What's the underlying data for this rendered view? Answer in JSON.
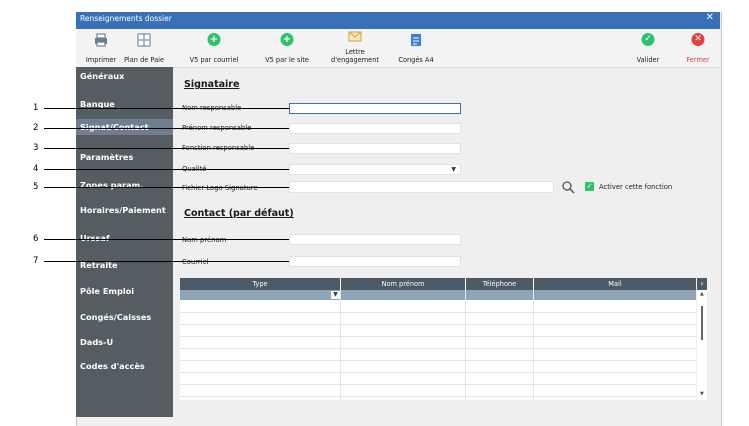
{
  "window": {
    "title": "Renseignements dossier",
    "close": "✕"
  },
  "toolbar": {
    "print": "Imprimer",
    "plan": "Plan de Paie",
    "v5_mail": "V5 par courriel",
    "v5_site": "V5 par le site",
    "letter_line1": "Lettre",
    "letter_line2": "d'engagement",
    "conges": "Congés A4",
    "validate": "Valider",
    "close": "Fermer"
  },
  "sidebar": {
    "items": [
      "Généraux",
      "Banque",
      "Signat/Contact",
      "Paramètres",
      "Zones param.",
      "Horaires/Paiement",
      "Urssaf",
      "Retraite",
      "Pôle Emploi",
      "Congés/Caisses",
      "Dads-U",
      "Codes d'accès"
    ],
    "selected": "Signat/Contact"
  },
  "signataire": {
    "heading": "Signataire",
    "nom_label": "Nom responsable",
    "prenom_label": "Prénom responsable",
    "fonction_label": "Fonction responsable",
    "qualite_label": "Qualité",
    "logo_label": "Fichier Logo Signature",
    "activate_label": "Activer cette fonction",
    "activate_checked": true
  },
  "contact": {
    "heading": "Contact (par défaut)",
    "nom_label": "Nom prénom",
    "courriel_label": "Courriel"
  },
  "grid": {
    "columns": [
      "Type",
      "Nom prénom",
      "Téléphone",
      "Mail"
    ]
  },
  "callouts": [
    "1",
    "2",
    "3",
    "4",
    "5",
    "6",
    "7"
  ],
  "colors": {
    "titlebar": "#3a70b8",
    "sidebar": "#555d62",
    "green": "#2ec26a",
    "red": "#e0413b"
  }
}
